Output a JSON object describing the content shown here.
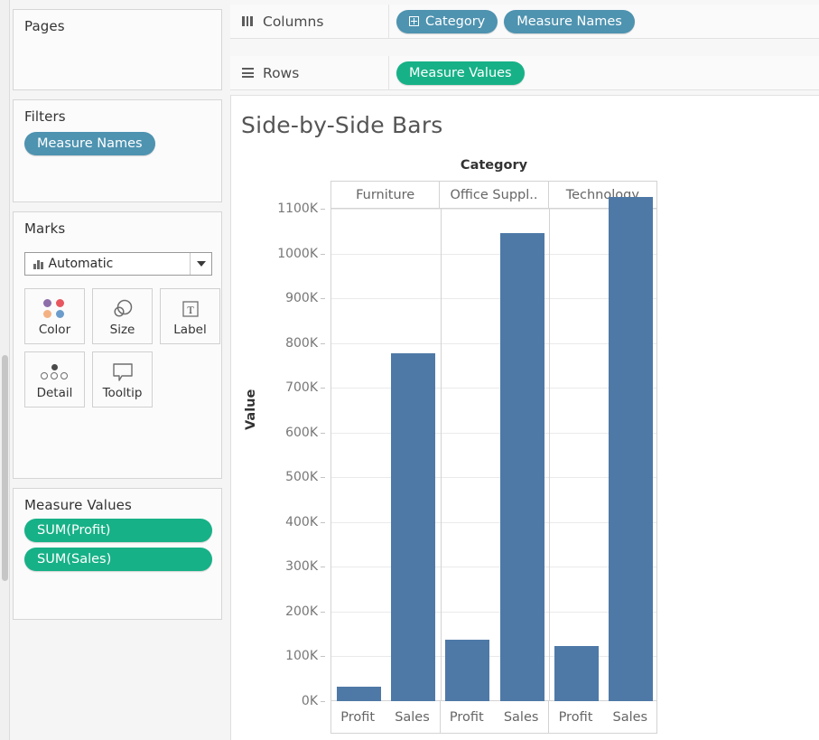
{
  "sidebar": {
    "pages": {
      "title": "Pages"
    },
    "filters": {
      "title": "Filters",
      "pills": [
        {
          "label": "Measure Names",
          "color": "#4e93b0"
        }
      ]
    },
    "marks": {
      "title": "Marks",
      "mark_type": "Automatic",
      "mark_type_icon": "bar-chart-icon",
      "caret_icon": "chevron-down-icon",
      "buttons": [
        {
          "label": "Color",
          "icon": "color-dots-icon"
        },
        {
          "label": "Size",
          "icon": "size-circles-icon"
        },
        {
          "label": "Label",
          "icon": "text-label-icon"
        },
        {
          "label": "Detail",
          "icon": "detail-dots-icon"
        },
        {
          "label": "Tooltip",
          "icon": "tooltip-bubble-icon"
        }
      ]
    },
    "measure_values": {
      "title": "Measure Values",
      "pills": [
        {
          "label": "SUM(Profit)",
          "color": "#17b187"
        },
        {
          "label": "SUM(Sales)",
          "color": "#17b187"
        }
      ]
    }
  },
  "shelves": {
    "columns": {
      "label": "Columns",
      "icon": "columns-icon",
      "pills": [
        {
          "label": "Category",
          "color": "#4e93b0",
          "has_expand": true
        },
        {
          "label": "Measure Names",
          "color": "#4e93b0",
          "has_expand": false
        }
      ]
    },
    "rows": {
      "label": "Rows",
      "icon": "rows-icon",
      "pills": [
        {
          "label": "Measure Values",
          "color": "#17b187",
          "has_expand": false
        }
      ]
    }
  },
  "chart_data": {
    "type": "bar",
    "title": "Side-by-Side Bars",
    "xlabel": "Category",
    "ylabel": "Value",
    "ylim": [
      0,
      1100000
    ],
    "ytick_labels": [
      "0K",
      "100K",
      "200K",
      "300K",
      "400K",
      "500K",
      "600K",
      "700K",
      "800K",
      "900K",
      "1000K",
      "1100K"
    ],
    "ytick_values": [
      0,
      100000,
      200000,
      300000,
      400000,
      500000,
      600000,
      700000,
      800000,
      900000,
      1000000,
      1100000
    ],
    "grid": true,
    "legend": "none",
    "categories": [
      "Furniture",
      "Office Suppl..",
      "Technology"
    ],
    "sub_categories": [
      "Profit",
      "Sales"
    ],
    "bar_color": "#4e79a7",
    "series": [
      {
        "name": "Profit",
        "values": [
          33000,
          138000,
          123000
        ]
      },
      {
        "name": "Sales",
        "values": [
          778000,
          1046000,
          1127000
        ]
      }
    ]
  }
}
